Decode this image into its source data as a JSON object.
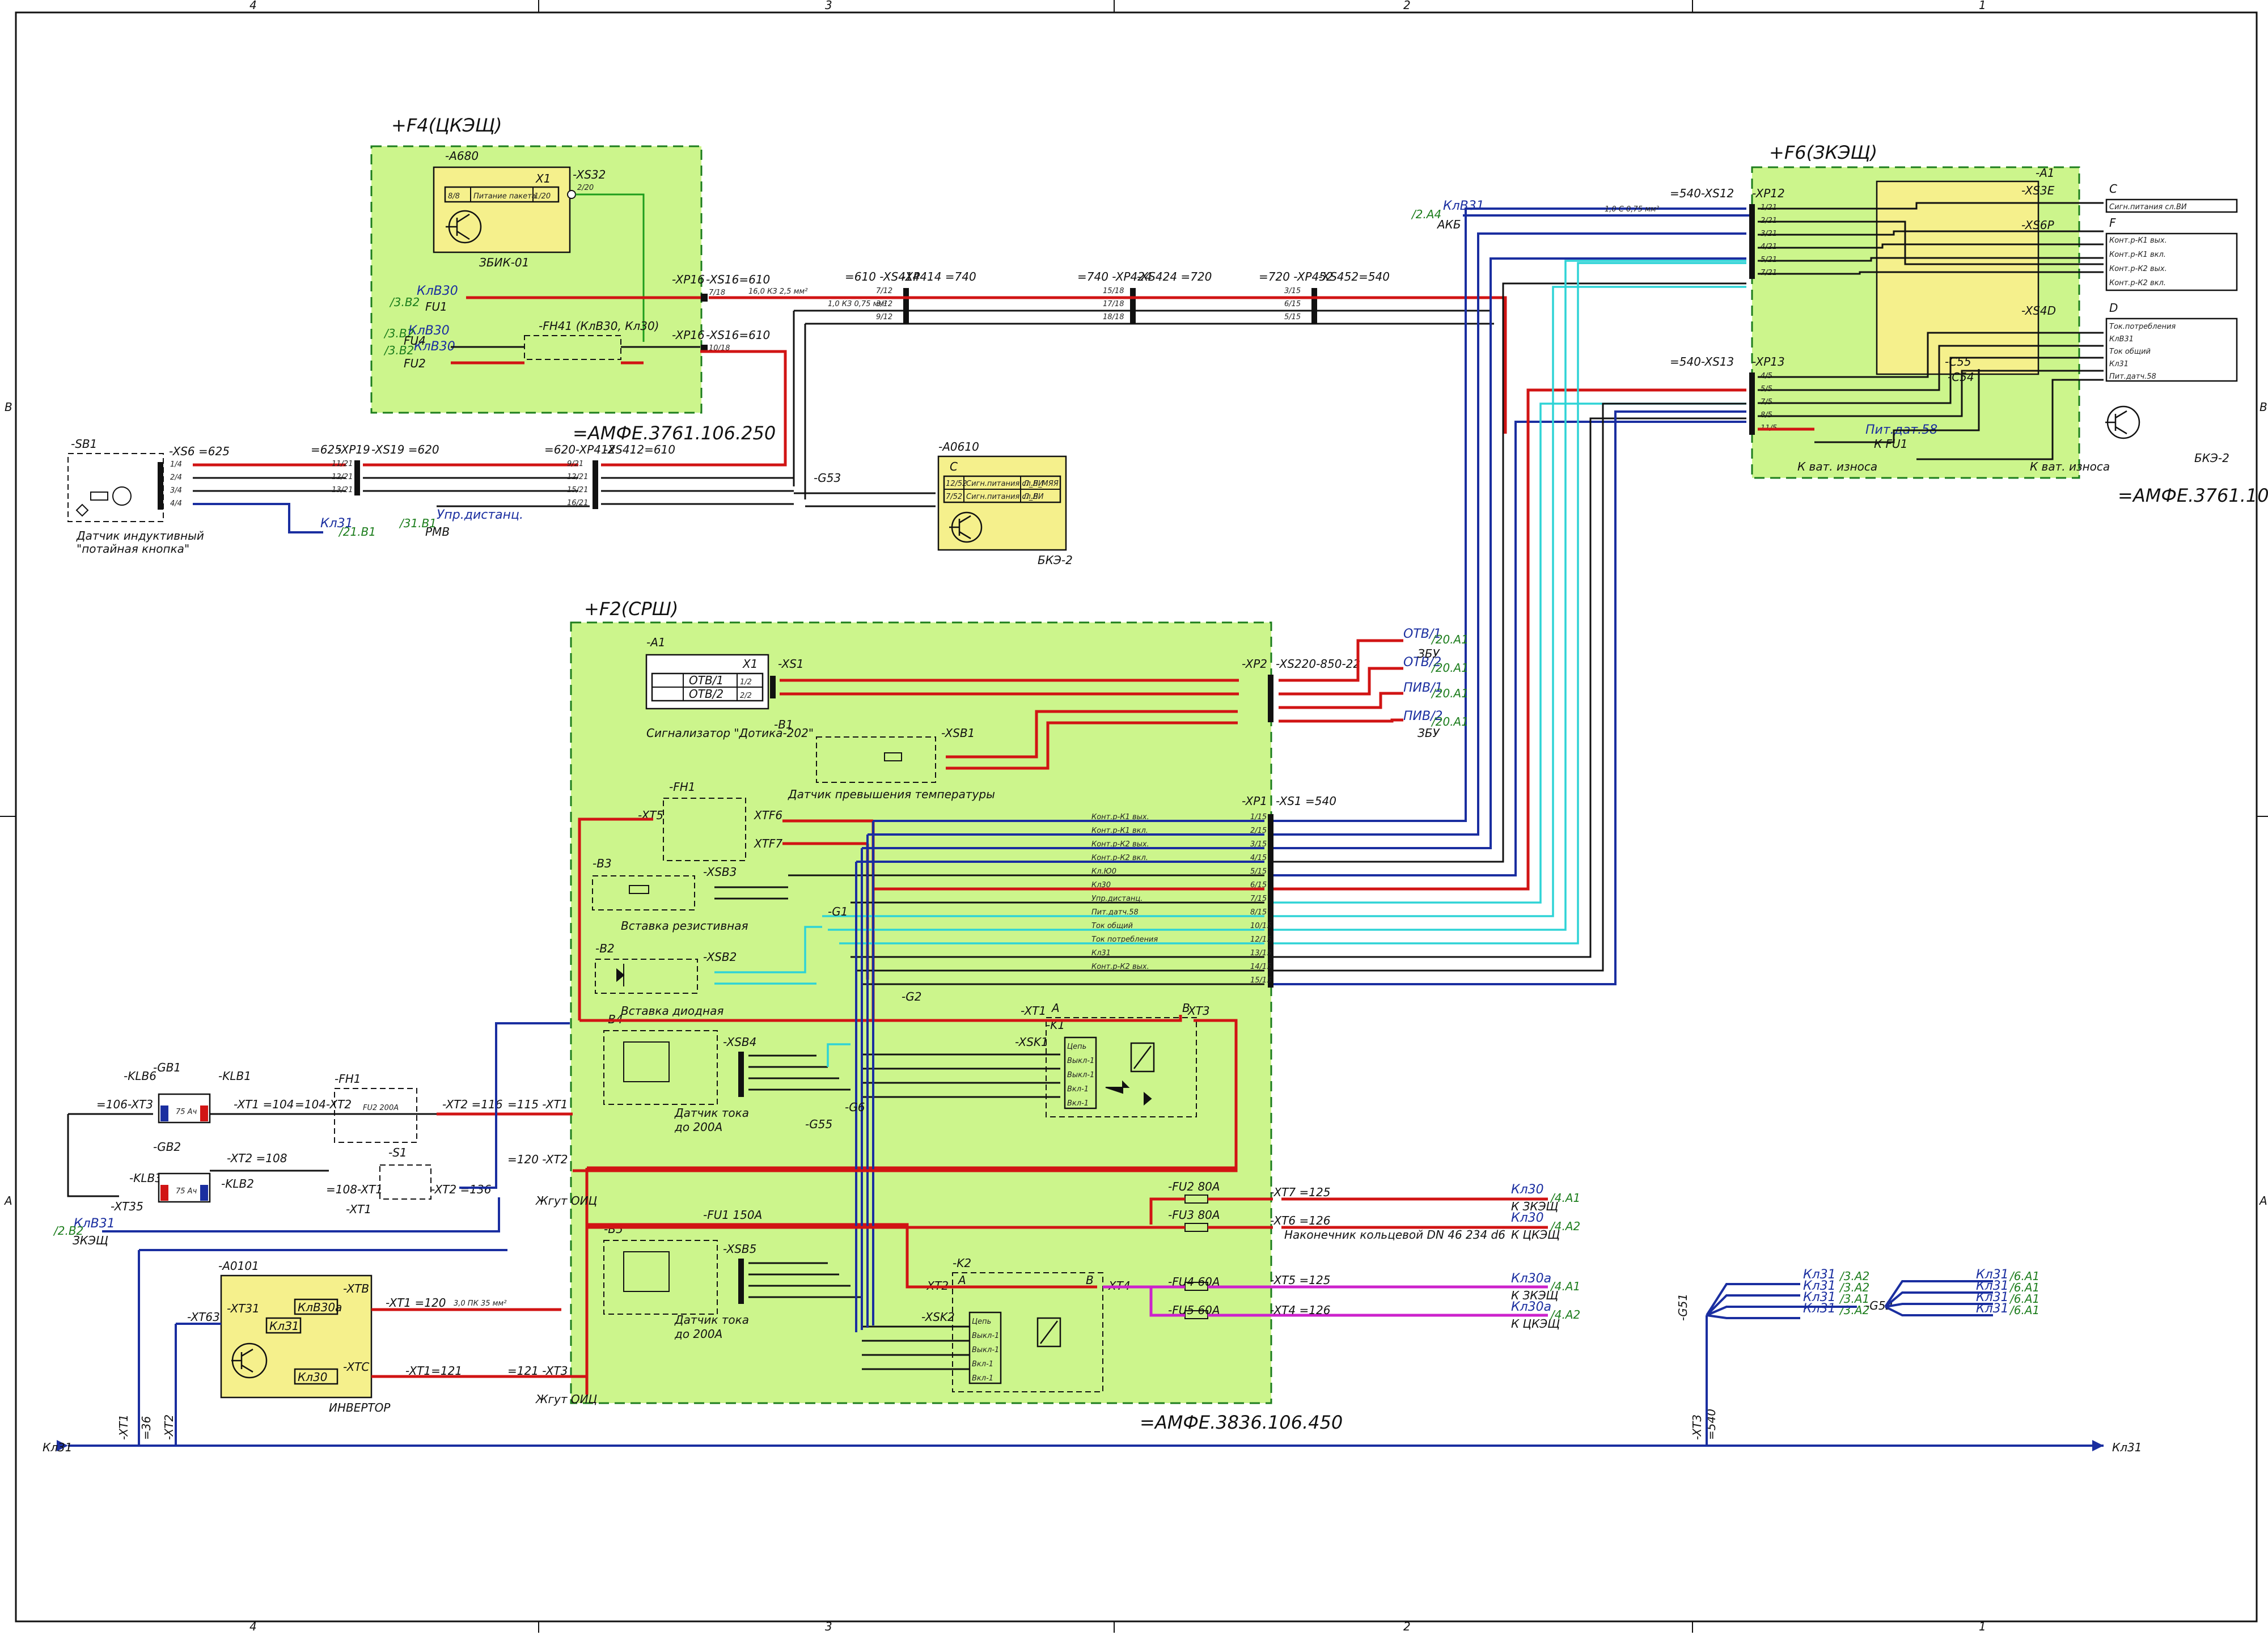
{
  "frame": {
    "zones_top": [
      "4",
      "3",
      "2",
      "1"
    ],
    "zones_bottom": [
      "4",
      "3",
      "2",
      "1"
    ],
    "rows_left": [
      "B",
      "A"
    ],
    "rows_right": [
      "B",
      "A"
    ]
  },
  "blocks": {
    "f4": {
      "title": "+F4(ЦКЭЩ)",
      "sub": "-A680",
      "x1": "X1",
      "xs32": "-XS32",
      "pin_in": "8/8",
      "pin_label": "Питание пакета",
      "pin_no": "1/20",
      "pin_out": "2/20",
      "device": "ЗБИК-01",
      "fu1": "FU1",
      "fu2": "FU2",
      "fu4": "FU4",
      "fh41": "-FH41 (КлВ30, Кл30)",
      "kl_b30a": "КлВ30",
      "kl_b30b": "КлВ30",
      "kl_b30c": "КлВ30",
      "ref1": "/3.B2",
      "ref2": "/3.B2",
      "ref3": "/3.B2",
      "xp16a": "-XP16",
      "xs16a": "-XS16=610",
      "xp16b": "-XP16",
      "xs16b": "-XS16=610",
      "p1": "7/18",
      "p2": "10/18",
      "doc": "=АМФЕ.3761.106.250"
    },
    "sb1": {
      "label": "-SB1",
      "xs6": "-XS6 =625",
      "pins": [
        "1/4",
        "2/4",
        "3/4",
        "4/4"
      ],
      "caption1": "Датчик индуктивный",
      "caption2": "\"потайная кнопка\"",
      "kl31": "Кл31",
      "ref": "/21.B1"
    },
    "mid": {
      "c625": "=625",
      "xp19": "-XP19",
      "xs19": "-XS19 =620",
      "c620": "=620-XP412",
      "xs412": "-XS412=610",
      "p1": [
        "11/21",
        "12/21",
        "13/21"
      ],
      "p2": [
        "9/21",
        "12/21",
        "15/21",
        "16/21"
      ],
      "ur": "Упр.дистанц.",
      "rmv": "РМВ",
      "ref": "/31.B1"
    },
    "top_conn": {
      "c1": "=610 -XS414",
      "c2": "-XP414 =740",
      "c3": "=740 -XP424",
      "c4": "-XS424 =720",
      "c5": "=720 -XP452",
      "c6": "-XS452=540",
      "p414": [
        "7/12",
        "3/12",
        "9/12"
      ],
      "p424": [
        "15/18",
        "17/18",
        "18/18"
      ],
      "p452": [
        "3/15",
        "6/15",
        "5/15"
      ],
      "g53": "-G53"
    },
    "a0610": {
      "label": "-A0610",
      "c": "C",
      "pins": [
        "12/52",
        "7/52"
      ],
      "rows": [
        "Сигн.питания сл.ВИ",
        "Сигн.питания сл.ВИ"
      ],
      "vals": [
        "Л_Л_МЯЯ",
        "Л_Л"
      ],
      "name": "БКЭ-2"
    },
    "f6": {
      "title": "+F6(ЗКЭЩ)",
      "a1": "-A1",
      "xs512": "=540-XS12",
      "xp12": "-XP12",
      "xs3e": "-XS3E",
      "xs6r": "-XS6Р",
      "xs4d": "-XS4D",
      "c": "C",
      "f": "F",
      "d": "D",
      "xs513": "=540-XS13",
      "xp13": "-XP13",
      "kl31": "КлВ31",
      "akb": "АКБ",
      "ref": "/2.A4",
      "pins12": [
        "1/21",
        "2/21",
        "3/21",
        "4/21",
        "5/21",
        "7/21"
      ],
      "pins13": [
        "4/5",
        "5/5",
        "7/5",
        "8/5",
        "11/5"
      ],
      "rows_c": [
        "Сигн.питания сл.ВИ"
      ],
      "rows_f": [
        "Конт.р-К1 вых.",
        "Конт.р-К1 вкл.",
        "Конт.р-К2 вых.",
        "Конт.р-К2 вкл."
      ],
      "rows_d": [
        "Ток.потребления",
        "КлВ31",
        "Ток общий",
        "Кл31",
        "Пит.датч.58"
      ],
      "litdat": "Пит.дат.58",
      "kfu1": "К FU1",
      "kvat1": "К ват. износа",
      "kvat2": "К ват. износа",
      "name": "БКЭ-2",
      "doc": "=АМФЕ.3761.106.350",
      "c55": "-C55",
      "c54": "-C54"
    },
    "f2": {
      "title": "+F2(СРШ)",
      "a1": "-A1",
      "x1": "X1",
      "xs1": "-XS1",
      "otv1": "ОТВ/1",
      "otv2": "ОТВ/2",
      "p12": "1/2",
      "p22": "2/2",
      "device": "Сигнализатор \"Дотика-202\"",
      "b1": "-B1",
      "xsb1": "-XSB1",
      "b1cap": "Датчик превышения температуры",
      "xp2": "-XP2",
      "xs220": "-XS220-850-22",
      "fh1": "-FH1",
      "xt5": "-XT5",
      "xtf6": "XTF6",
      "xtf7": "XTF7",
      "b3": "-B3",
      "xsb3": "-XSB3",
      "b3cap": "Вставка резистивная",
      "b2": "-B2",
      "xsb2": "-XSB2",
      "b2cap": "Вставка диодная",
      "b4": "-B4",
      "xsb4": "-XSB4",
      "b4cap1": "Датчик тока",
      "b4cap2": "до 200А",
      "b5": "-B5",
      "xsb5": "-XSB5",
      "b5cap1": "Датчик тока",
      "b5cap2": "до 200А",
      "k1": "-K1",
      "xt1": "-XT1",
      "xt3": "XT3",
      "xsk1": "-XSK1",
      "k2": "-K2",
      "xt2": "-XT2",
      "xt4": "XT4",
      "xsk2": "-XSK2",
      "relay_rows": [
        "Цепь",
        "Выкл-1",
        "Выкл-1",
        "Вкл-1",
        "Вкл-1"
      ],
      "xp1": "-XP1",
      "xs1b": "-XS1 =540",
      "signals": [
        "Конт.р-К1 вых.",
        "Конт.р-К1 вкл.",
        "Конт.р-К2 вых.",
        "Конт.р-К2 вкл.",
        "Кл.Ю0",
        "Кл30",
        "Упр.дистанц.",
        "Пит.датч.58",
        "Ток общий",
        "Ток потребления",
        "Кл31",
        "Конт.р-К2 вых."
      ],
      "xp1pins": [
        "1/15",
        "2/15",
        "3/15",
        "4/15",
        "5/15",
        "6/15",
        "7/15",
        "8/15",
        "10/15",
        "12/15",
        "13/15",
        "14/15",
        "15/15"
      ],
      "a": "A",
      "b": "B",
      "g1": "-G1",
      "g2": "-G2",
      "g55": "-G55",
      "g6": "-G6",
      "fu1": "-FU1 150А",
      "doc": "=АМФЕ.3836.106.450",
      "otv_r1": "ОТВ/1",
      "otv_r2": "ОТВ/2",
      "piv1": "ПИВ/1",
      "piv2": "ПИВ/2",
      "zbu": "ЗБУ",
      "refs": [
        "/20.A1",
        "/20.A1",
        "/20.A1",
        "/20.A1"
      ],
      "a_label": "A",
      "b_label": "B"
    },
    "left": {
      "klb6": "-KLB6",
      "gb1": "-GB1",
      "klb1": "-KLB1",
      "c106": "=106-XT3",
      "xt1a": "-XT1 =104",
      "xt2a": "=104-XT2",
      "fh1": "-FH1",
      "fh1v": "FU2 200А",
      "xt2b": "-XT2 =116",
      "c115": "=115 -XT1",
      "gb2": "-GB2",
      "xt2c": "-XT2 =108",
      "klb3": "-KLB3",
      "klb2": "-KLB2",
      "xt35": "-XT35",
      "c108": "=108-XT1",
      "s1": "-S1",
      "xt2d": "-XT2 =136",
      "xt1b": "-XT1",
      "c120": "=120 -XT2",
      "zhgut1": "Жгут ОИЦ",
      "klb31": "КлВ31",
      "zkesh": "ЗКЭЩ",
      "ref": "/2.B2",
      "cap75a": "75 Ач",
      "cap75b": "75 Ач"
    },
    "a0101": {
      "label": "-A0101",
      "xt31": "-XT31",
      "klb30a": "КлВ30а",
      "kl31": "КлЗ1",
      "xtb": "-XTB",
      "xtc": "-XTC",
      "kl30": "Кл30",
      "name": "ИНВЕРТОР",
      "xt63": "-XT63",
      "xt1": "-XT1 =120",
      "xt1b": "-XT1=121",
      "c121": "=121 -XT3",
      "zhgut2": "Жгут ОИЦ"
    },
    "outputs": {
      "fu2": "-FU2 80А",
      "fu3": "-FU3 80А",
      "fu4": "-FU4 60А",
      "fu5": "-FU5 60А",
      "xt7": "-XT7 =125",
      "xt6": "-XT6 =126",
      "xt5": "-XT5 =125",
      "xt4": "-XT4 =126",
      "ring": "Наконечник кольцевой DN 46 234 d6",
      "kl30a": "Кл30",
      "kl30b": "Кл30",
      "kl30c": "Кл30а",
      "kl30d": "Кл30а",
      "k_zkesh": "К ЗКЭЩ",
      "k_ckesh": "К ЦКЭЩ",
      "k_zkesh2": "К ЗКЭЩ",
      "k_ckesh2": "К ЦКЭЩ",
      "refs": [
        "/4.A1",
        "/4.A2",
        "/4.A1",
        "/4.A2"
      ]
    },
    "bus": {
      "left": "Кл31",
      "right": "Кл31",
      "xt1": "-XT1",
      "c36": "=36",
      "xt2": "-XT2",
      "xt3": "-XT3",
      "c540": "=540",
      "g51": "-G51",
      "g52": "-G52",
      "kl31": [
        "Кл31",
        "Кл31",
        "Кл31",
        "Кл31",
        "Кл31",
        "Кл31",
        "Кл31",
        "Кл31"
      ],
      "refs_a": [
        "/3.A2",
        "/3.A2",
        "/3.A1",
        "/3.A2"
      ],
      "refs_b": [
        "/6.A1",
        "/6.A1",
        "/6.A1",
        "/6.A1"
      ]
    }
  },
  "colors": {
    "zone": "#ccf58c",
    "yellow": "#f5f08c",
    "red": "#d11414",
    "blue": "#1a2ea0",
    "cyan": "#2ed3d6",
    "magenta": "#cc22cc",
    "green": "#1c9d1c",
    "black": "#111111"
  },
  "wire_labels": {
    "short": "1,0 КЗ 0,75 мм²",
    "red": "16,0 КЗ 2,5 мм²",
    "blue": "1,0 С 0,75 мм²",
    "thick": "3,0 ПК 35 мм²"
  }
}
